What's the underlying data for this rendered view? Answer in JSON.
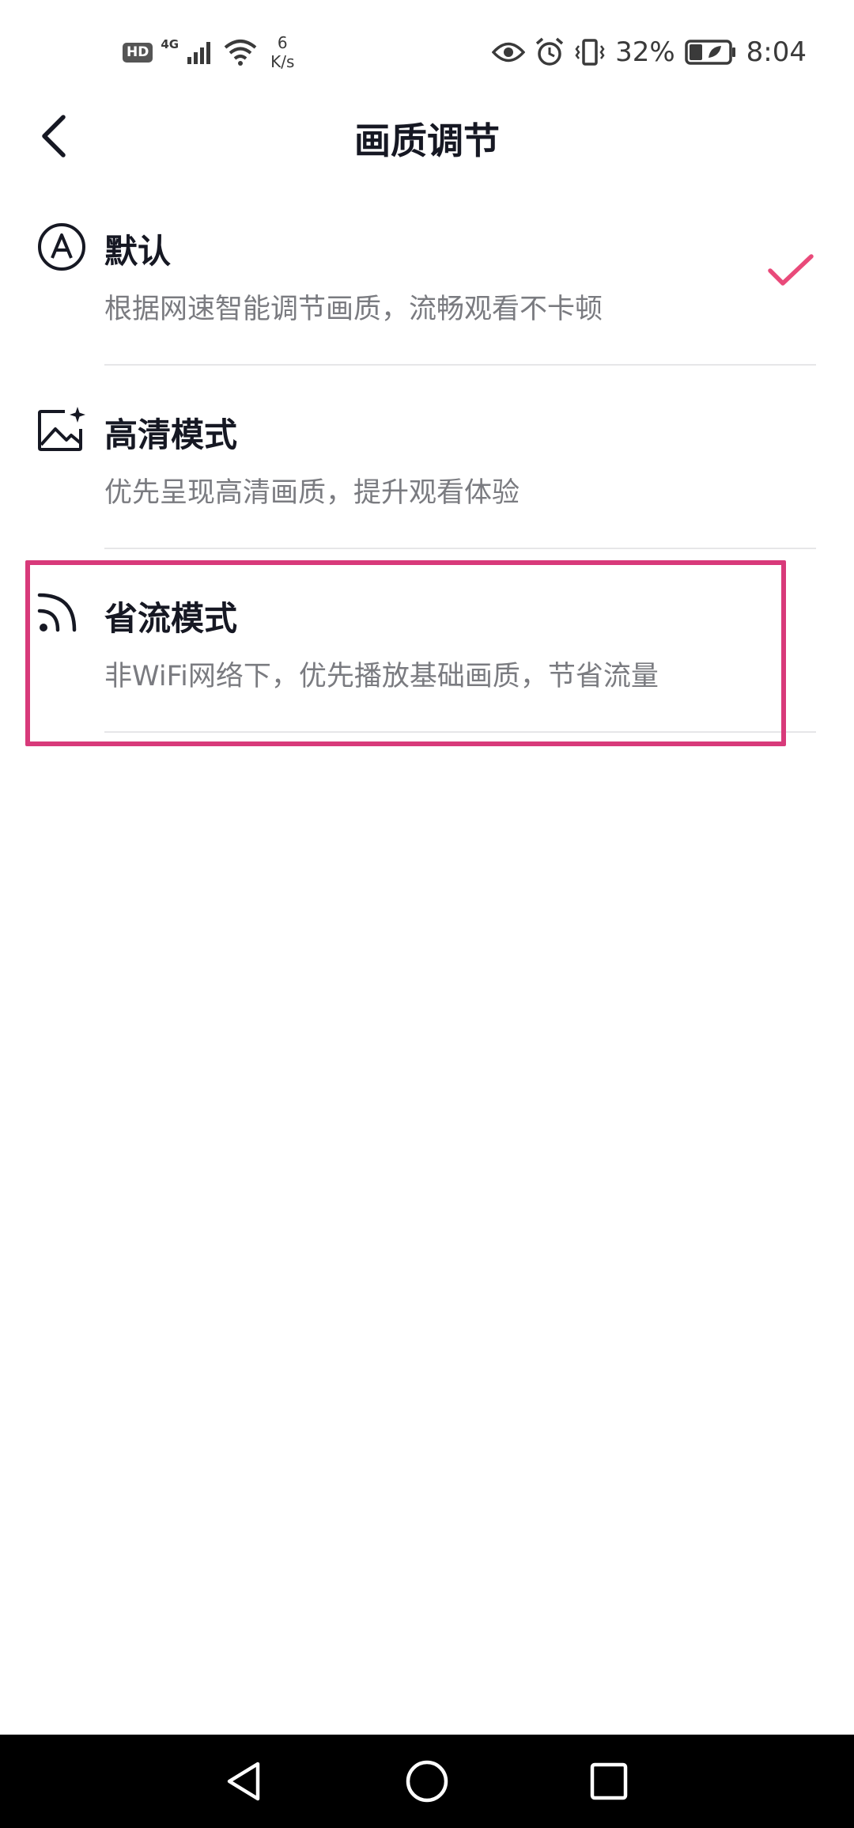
{
  "status_bar": {
    "hd_badge": "HD",
    "network": "4G",
    "network_speed_value": "6",
    "network_speed_unit": "K/s",
    "battery_percent": "32%",
    "time": "8:04"
  },
  "header": {
    "title": "画质调节"
  },
  "options": [
    {
      "title": "默认",
      "description": "根据网速智能调节画质，流畅观看不卡顿",
      "icon": "auto-a-icon",
      "selected": true
    },
    {
      "title": "高清模式",
      "description": "优先呈现高清画质，提升观看体验",
      "icon": "hd-image-icon",
      "selected": false
    },
    {
      "title": "省流模式",
      "description": "非WiFi网络下，优先播放基础画质，节省流量",
      "icon": "data-saver-icon",
      "selected": false
    }
  ],
  "colors": {
    "accent": "#e94a7a",
    "highlight": "#d83a7a",
    "title_text": "#161823",
    "desc_text": "#7a7b80"
  },
  "nav_bar": {
    "buttons": [
      "back-triangle-icon",
      "home-circle-icon",
      "recents-square-icon"
    ]
  }
}
